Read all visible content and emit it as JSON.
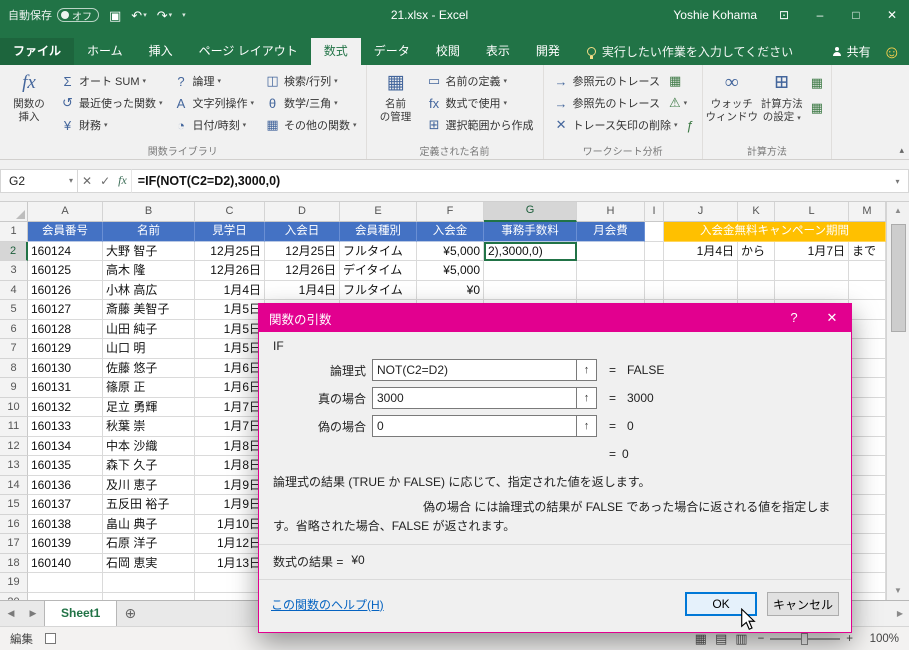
{
  "colors": {
    "excel_green": "#217346",
    "header_blue": "#4472C4",
    "campaign_orange": "#FFC000",
    "dialog_magenta": "#E2008F",
    "selection_green": "#217346",
    "link_blue": "#0563C1",
    "ok_focus_blue": "#0078D7"
  },
  "icons": {
    "autosave_dot": "●",
    "save": "▣",
    "undo": "↶",
    "redo": "↷",
    "dropdown": "▾",
    "qat_more": "▾",
    "ribbon_display": "⊡",
    "minimize": "–",
    "maximize": "□",
    "close": "✕",
    "smiley": "☺",
    "cancel_x": "✕",
    "enter_check": "✓",
    "fx": "fx",
    "bar_expand": "▾",
    "collapse_ribbon": "▴",
    "scroll_up": "▲",
    "scroll_down": "▼",
    "scroll_left": "◀",
    "scroll_right": "▶",
    "nav_left": "◀",
    "nav_right": "▶",
    "add_sheet": "⊕",
    "view_normal": "▦",
    "view_layout": "▤",
    "view_break": "▥",
    "zoom_minus": "−",
    "zoom_plus": "+",
    "range_picker": "↑"
  },
  "titlebar": {
    "autosave_label": "自動保存",
    "autosave_state": "オフ",
    "title": "21.xlsx  -  Excel",
    "user": "Yoshie Kohama"
  },
  "ribbon": {
    "tabs": [
      {
        "id": "file",
        "label": "ファイル",
        "file": true
      },
      {
        "id": "home",
        "label": "ホーム"
      },
      {
        "id": "insert",
        "label": "挿入"
      },
      {
        "id": "page-layout",
        "label": "ページ レイアウト"
      },
      {
        "id": "formulas",
        "label": "数式",
        "active": true
      },
      {
        "id": "data",
        "label": "データ"
      },
      {
        "id": "review",
        "label": "校閲"
      },
      {
        "id": "view",
        "label": "表示"
      },
      {
        "id": "developer",
        "label": "開発"
      }
    ],
    "tell_me": "実行したい作業を入力してください",
    "share_label": "共有",
    "groups": [
      {
        "id": "function-library",
        "name": "関数ライブラリ",
        "type": "library",
        "big": {
          "id": "insert-function",
          "glyph": "fx",
          "lines": [
            "関数の",
            "挿入"
          ]
        },
        "cols": [
          [
            {
              "id": "autosum",
              "glyph": "Σ",
              "label": "オート SUM",
              "dd": true
            },
            {
              "id": "recent-functions",
              "glyph": "↺",
              "label": "最近使った関数",
              "dd": true
            },
            {
              "id": "financial",
              "glyph": "¥",
              "label": "財務",
              "dd": true
            }
          ],
          [
            {
              "id": "logical",
              "glyph": "?",
              "label": "論理",
              "dd": true
            },
            {
              "id": "text-functions",
              "glyph": "A",
              "label": "文字列操作",
              "dd": true
            },
            {
              "id": "date-time",
              "glyph": "◔",
              "label": "日付/時刻",
              "dd": true
            }
          ],
          [
            {
              "id": "lookup-reference",
              "glyph": "◫",
              "label": "検索/行列",
              "dd": true
            },
            {
              "id": "math-trig",
              "glyph": "θ",
              "label": "数学/三角",
              "dd": true
            },
            {
              "id": "more-functions",
              "glyph": "▦",
              "label": "その他の関数",
              "dd": true
            }
          ]
        ]
      },
      {
        "id": "defined-names",
        "name": "定義された名前",
        "type": "names",
        "big": {
          "id": "name-manager",
          "glyph": "▦",
          "lines": [
            "名前",
            "の管理"
          ]
        },
        "items": [
          {
            "id": "define-name",
            "glyph": "▭",
            "label": "名前の定義",
            "dd": true
          },
          {
            "id": "use-in-formula",
            "glyph": "fx",
            "label": "数式で使用",
            "dd": true
          },
          {
            "id": "create-from-selection",
            "glyph": "⊞",
            "label": "選択範囲から作成"
          }
        ]
      },
      {
        "id": "formula-auditing",
        "name": "ワークシート分析",
        "type": "audit",
        "rows": [
          {
            "id": "trace-precedents",
            "glyph": "→",
            "label": "参照元のトレース",
            "trail": {
              "id": "show-formulas",
              "glyph": "▦"
            }
          },
          {
            "id": "trace-dependents",
            "glyph": "→",
            "label": "参照先のトレース",
            "trail": {
              "id": "error-checking",
              "glyph": "⚠",
              "dd": true
            }
          },
          {
            "id": "remove-arrows",
            "glyph": "✕",
            "label": "トレース矢印の削除",
            "dd": true,
            "trail": {
              "id": "evaluate-formula",
              "glyph": "ƒ"
            }
          }
        ]
      },
      {
        "id": "calculation",
        "name": "計算方法",
        "type": "calc",
        "bigs": [
          {
            "id": "watch-window",
            "glyph": "∞",
            "lines": [
              "ウォッチ",
              "ウィンドウ"
            ]
          },
          {
            "id": "calculation-options",
            "glyph": "⊞",
            "lines": [
              "計算方法",
              "の設定"
            ],
            "dd": true
          }
        ],
        "stack": [
          {
            "id": "calculate-now",
            "glyph": "▦"
          },
          {
            "id": "calculate-sheet",
            "glyph": "▦"
          }
        ]
      }
    ]
  },
  "formula_bar": {
    "name_box": "G2",
    "formula": "=IF(NOT(C2=D2),3000,0)"
  },
  "grid": {
    "columns": [
      "A",
      "B",
      "C",
      "D",
      "E",
      "F",
      "G",
      "H",
      "I",
      "J",
      "K",
      "L",
      "M"
    ],
    "col_align": [
      "left",
      "left",
      "right",
      "right",
      "left",
      "right",
      "right",
      "right",
      "left",
      "right",
      "left",
      "right",
      "left"
    ],
    "selected": {
      "col": "G",
      "row": 2
    },
    "header_row": [
      "会員番号",
      "名前",
      "見学日",
      "入会日",
      "会員種別",
      "入会金",
      "事務手数料",
      "月会費"
    ],
    "campaign_header": "入会金無料キャンペーン期間",
    "data_rows": [
      [
        "160124",
        "大野 智子",
        "12月25日",
        "12月25日",
        "フルタイム",
        "¥5,000",
        "2),3000,0)",
        "",
        "",
        "1月4日",
        "から",
        "1月7日",
        "まで"
      ],
      [
        "160125",
        "高木 隆",
        "12月26日",
        "12月26日",
        "デイタイム",
        "¥5,000"
      ],
      [
        "160126",
        "小林 高広",
        "1月4日",
        "1月4日",
        "フルタイム",
        "¥0"
      ],
      [
        "160127",
        "斎藤 美智子",
        "1月5日"
      ],
      [
        "160128",
        "山田 純子",
        "1月5日"
      ],
      [
        "160129",
        "山口 明",
        "1月5日"
      ],
      [
        "160130",
        "佐藤 悠子",
        "1月6日"
      ],
      [
        "160131",
        "篠原 正",
        "1月6日"
      ],
      [
        "160132",
        "足立 勇輝",
        "1月7日"
      ],
      [
        "160133",
        "秋葉 崇",
        "1月7日"
      ],
      [
        "160134",
        "中本 沙織",
        "1月8日"
      ],
      [
        "160135",
        "森下 久子",
        "1月8日"
      ],
      [
        "160136",
        "及川 恵子",
        "1月9日"
      ],
      [
        "160137",
        "五反田 裕子",
        "1月9日"
      ],
      [
        "160138",
        "畠山 典子",
        "1月10日"
      ],
      [
        "160139",
        "石原 洋子",
        "1月12日"
      ],
      [
        "160140",
        "石岡 恵実",
        "1月13日"
      ]
    ]
  },
  "dialog": {
    "title": "関数の引数",
    "help_button": "?",
    "close_button": "✕",
    "function_name": "IF",
    "fields": [
      {
        "label": "論理式",
        "value": "NOT(C2=D2)",
        "eq": "=",
        "result": "FALSE"
      },
      {
        "label": "真の場合",
        "value": "3000",
        "eq": "=",
        "result": "3000"
      },
      {
        "label": "偽の場合",
        "value": "0",
        "eq": "=",
        "result": "0"
      }
    ],
    "overall_eq": "=",
    "overall_result": "0",
    "description": "論理式の結果 (TRUE か FALSE) に応じて、指定された値を返します。",
    "arg_name": "偽の場合",
    "arg_description": "には論理式の結果が FALSE であった場合に返される値を指定します。省略された場合、FALSE が返されます。",
    "formula_result_label": "数式の結果 =",
    "formula_result_value": "¥0",
    "help_link": "この関数のヘルプ(H)",
    "ok": "OK",
    "cancel": "キャンセル"
  },
  "sheet": {
    "active_tab": "Sheet1"
  },
  "status_bar": {
    "mode": "編集",
    "zoom": "100%"
  }
}
